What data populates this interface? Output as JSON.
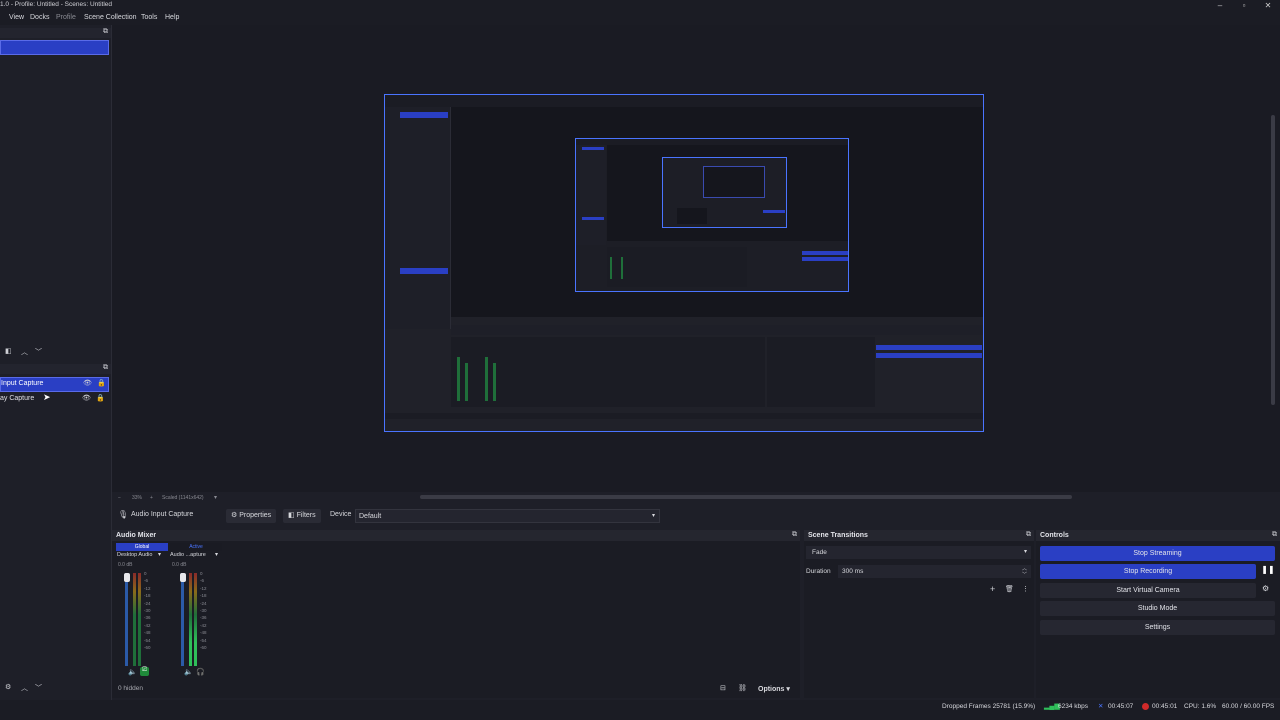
{
  "titlebar": {
    "title": "1.0 - Profile: Untitled - Scenes: Untitled",
    "minimize": "–",
    "restore": "▫",
    "close": "✕"
  },
  "menu": [
    "View",
    "Docks",
    "Profile",
    "Scene Collection",
    "Tools",
    "Help"
  ],
  "sources": [
    {
      "label": "Input Capture",
      "selected": true
    },
    {
      "label": "ay Capture",
      "selected": false
    }
  ],
  "preview": {
    "zoom": "33%",
    "scaled": "Scaled (1141x642)"
  },
  "toolbar": {
    "source_name": "Audio Input Capture",
    "properties": "Properties",
    "filters": "Filters",
    "device_label": "Device",
    "device_value": "Default"
  },
  "audio_mixer": {
    "title": "Audio Mixer",
    "channels": [
      {
        "global": "Global",
        "name": "Desktop Audio",
        "db": "0.0 dB"
      },
      {
        "global": "Active",
        "name": "Audio ...apture",
        "db": "0.0 dB"
      }
    ],
    "scale": [
      "0",
      "-6",
      "-12",
      "-18",
      "-24",
      "-30",
      "-36",
      "-42",
      "-48",
      "-54",
      "-60"
    ],
    "hidden": "0 hidden",
    "options": "Options"
  },
  "scene_transitions": {
    "title": "Scene Transitions",
    "transition": "Fade",
    "duration_label": "Duration",
    "duration_value": "300 ms"
  },
  "controls": {
    "title": "Controls",
    "stop_streaming": "Stop Streaming",
    "stop_recording": "Stop Recording",
    "start_virtual_camera": "Start Virtual Camera",
    "studio_mode": "Studio Mode",
    "settings": "Settings"
  },
  "status": {
    "dropped_frames": "Dropped Frames 25781 (15.9%)",
    "bitrate": "6234 kbps",
    "stream_time": "00:45:07",
    "rec_time": "00:45:01",
    "cpu": "CPU: 1.6%",
    "fps": "60.00 / 60.00 FPS"
  },
  "colors": {
    "accent": "#2a3fc4",
    "frame_border": "#4a74ff",
    "background": "#1e1f28"
  }
}
